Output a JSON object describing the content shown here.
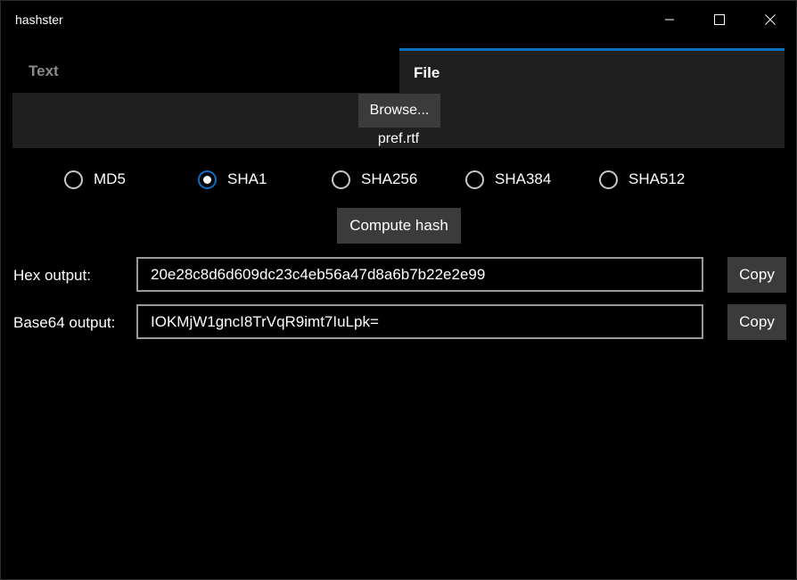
{
  "window": {
    "title": "hashster"
  },
  "tabs": [
    {
      "label": "Text",
      "selected": false
    },
    {
      "label": "File",
      "selected": true
    }
  ],
  "file_panel": {
    "browse_label": "Browse...",
    "file_name": "pref.rtf"
  },
  "algorithms": [
    {
      "label": "MD5",
      "checked": false
    },
    {
      "label": "SHA1",
      "checked": true
    },
    {
      "label": "SHA256",
      "checked": false
    },
    {
      "label": "SHA384",
      "checked": false
    },
    {
      "label": "SHA512",
      "checked": false
    }
  ],
  "compute_label": "Compute hash",
  "outputs": {
    "hex": {
      "label": "Hex output:",
      "value": "20e28c8d6d609dc23c4eb56a47d8a6b7b22e2e99",
      "copy_label": "Copy"
    },
    "base64": {
      "label": "Base64 output:",
      "value": "IOKMjW1gncI8TrVqR9imt7IuLpk=",
      "copy_label": "Copy"
    }
  },
  "colors": {
    "accent": "#0a6fc2",
    "background": "#000000",
    "panel": "#1f1f1f",
    "button": "#3b3b3b"
  }
}
